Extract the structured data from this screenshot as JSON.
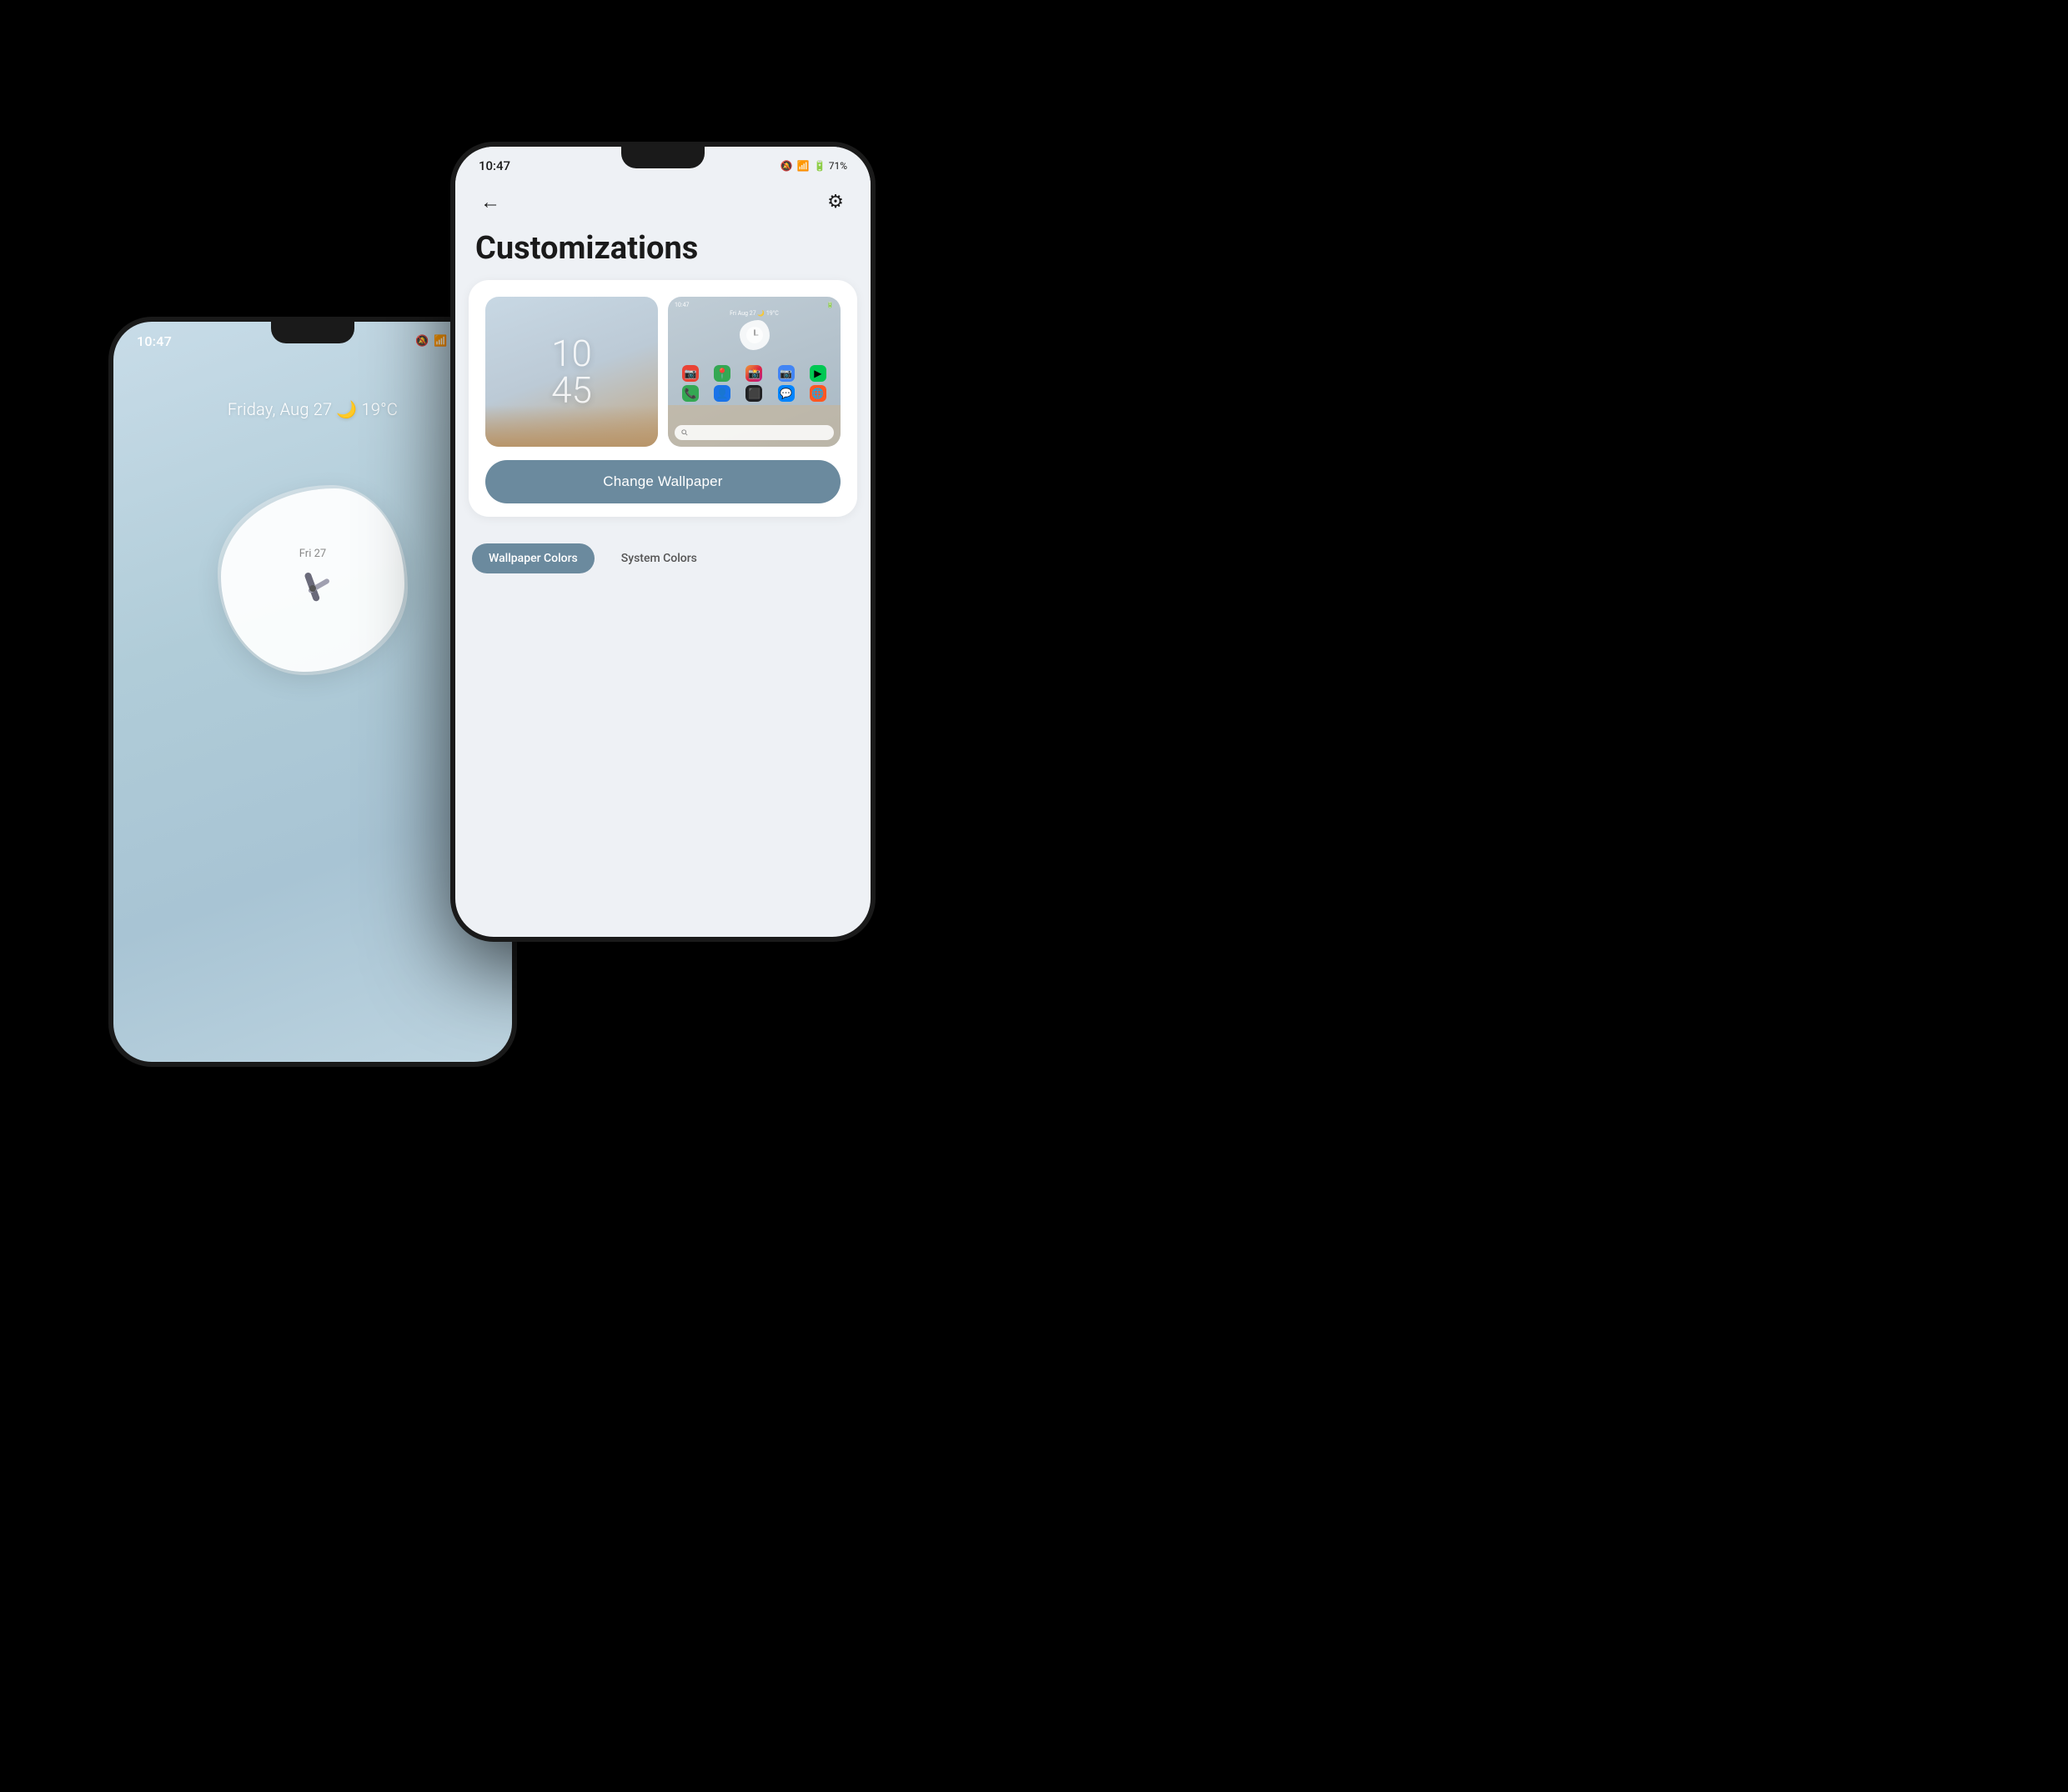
{
  "background": "#000000",
  "left_phone": {
    "status_time": "10:47",
    "status_icons": "🔕 📶 🔋 71%",
    "weather": "Friday, Aug 27 🌙 19°C",
    "clock_label": "Fri 27"
  },
  "right_phone": {
    "status_time": "10:47",
    "status_icons": "🔕 📶 🔋 71%",
    "back_icon": "←",
    "settings_icon": "⚙",
    "page_title": "Customizations",
    "clock_lock": "10\n45",
    "change_wallpaper_label": "Change Wallpaper",
    "tab_wallpaper_colors": "Wallpaper Colors",
    "tab_system_colors": "System Colors"
  }
}
